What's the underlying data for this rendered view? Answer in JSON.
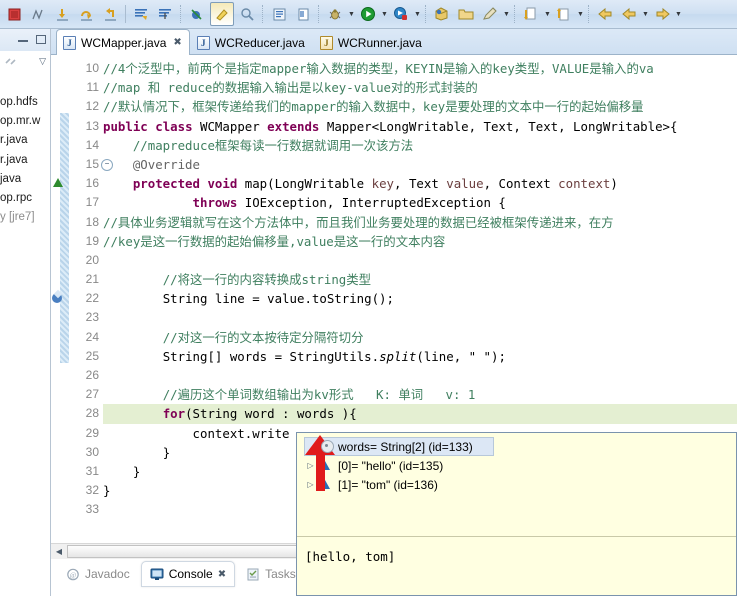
{
  "toolbar": {
    "buttons": [
      {
        "name": "terminate-icon",
        "glyph": "stop"
      },
      {
        "name": "disconnect-icon",
        "glyph": "disconnect"
      },
      {
        "name": "step-into-icon",
        "glyph": "step-into"
      },
      {
        "name": "step-over-icon",
        "glyph": "step-over"
      },
      {
        "name": "step-return-icon",
        "glyph": "step-return"
      },
      {
        "name": "toggle-ant-mark-occurrences-icon",
        "glyph": "lines"
      },
      {
        "name": "next-annotation-icon",
        "glyph": "lines2"
      },
      {
        "name": "skip-all-breakpoints-icon",
        "glyph": "breakpoint"
      },
      {
        "name": "toggle-mark-occurrences-icon",
        "glyph": "highlight"
      },
      {
        "name": "search-icon",
        "glyph": "search"
      },
      {
        "name": "open-type-icon",
        "glyph": "book"
      },
      {
        "name": "open-task-icon",
        "glyph": "task"
      },
      {
        "name": "debug-icon",
        "glyph": "bug"
      },
      {
        "name": "run-icon",
        "glyph": "run"
      },
      {
        "name": "external-tools-icon",
        "glyph": "tools"
      },
      {
        "name": "new-java-package-icon",
        "glyph": "package"
      },
      {
        "name": "open-resource-icon",
        "glyph": "folder"
      },
      {
        "name": "pencil-icon",
        "glyph": "pencil"
      },
      {
        "name": "next-edit-icon",
        "glyph": "edit-next"
      },
      {
        "name": "previous-edit-icon",
        "glyph": "edit-prev"
      },
      {
        "name": "back-icon",
        "glyph": "back"
      },
      {
        "name": "forward-icon",
        "glyph": "forward"
      }
    ]
  },
  "package_explorer": {
    "tree": [
      "op.hdfs",
      "op.mr.w",
      "r.java",
      "r.java",
      "java",
      "op.rpc",
      "y [jre7]"
    ]
  },
  "editor": {
    "tabs": [
      {
        "label": "WCMapper.java",
        "active": true,
        "closable": true,
        "icon": "java-file-icon"
      },
      {
        "label": "WCReducer.java",
        "active": false,
        "closable": false,
        "icon": "java-file-icon"
      },
      {
        "label": "WCRunner.java",
        "active": false,
        "closable": false,
        "icon": "java-file-warning-icon"
      }
    ],
    "lines": [
      {
        "num": 10,
        "marker": "",
        "fold": false,
        "highlight": false
      },
      {
        "num": 11,
        "marker": "",
        "fold": false,
        "highlight": false
      },
      {
        "num": 12,
        "marker": "",
        "fold": false,
        "highlight": false
      },
      {
        "num": 13,
        "marker": "",
        "fold": false,
        "highlight": false
      },
      {
        "num": 14,
        "marker": "",
        "fold": false,
        "highlight": false
      },
      {
        "num": 15,
        "marker": "",
        "fold": true,
        "highlight": false
      },
      {
        "num": 16,
        "marker": "override",
        "fold": false,
        "highlight": false
      },
      {
        "num": 17,
        "marker": "",
        "fold": false,
        "highlight": false
      },
      {
        "num": 18,
        "marker": "",
        "fold": false,
        "highlight": false
      },
      {
        "num": 19,
        "marker": "",
        "fold": false,
        "highlight": false
      },
      {
        "num": 20,
        "marker": "",
        "fold": false,
        "highlight": false
      },
      {
        "num": 21,
        "marker": "",
        "fold": false,
        "highlight": false
      },
      {
        "num": 22,
        "marker": "breakpoint",
        "fold": false,
        "highlight": false
      },
      {
        "num": 23,
        "marker": "",
        "fold": false,
        "highlight": false
      },
      {
        "num": 24,
        "marker": "",
        "fold": false,
        "highlight": false
      },
      {
        "num": 25,
        "marker": "",
        "fold": false,
        "highlight": false
      },
      {
        "num": 26,
        "marker": "",
        "fold": false,
        "highlight": false
      },
      {
        "num": 27,
        "marker": "",
        "fold": false,
        "highlight": false
      },
      {
        "num": 28,
        "marker": "",
        "fold": false,
        "highlight": true
      },
      {
        "num": 29,
        "marker": "",
        "fold": false,
        "highlight": false
      },
      {
        "num": 30,
        "marker": "",
        "fold": false,
        "highlight": false
      },
      {
        "num": 31,
        "marker": "",
        "fold": false,
        "highlight": false
      },
      {
        "num": 32,
        "marker": "",
        "fold": false,
        "highlight": false
      },
      {
        "num": 33,
        "marker": "",
        "fold": false,
        "highlight": false
      }
    ],
    "code": {
      "l10": "//4个泛型中，前两个是指定mapper输入数据的类型，KEYIN是输入的key类型，VALUE是输入的va",
      "l11": "//map 和 reduce的数据输入输出是以key-value对的形式封装的",
      "l12": "//默认情况下，框架传递给我们的mapper的输入数据中，key是要处理的文本中一行的起始偏移量",
      "l13_kw1": "public",
      "l13_kw2": "class",
      "l13_name": "WCMapper",
      "l13_kw3": "extends",
      "l13_rest": "Mapper<LongWritable, Text, Text, LongWritable>{",
      "l14": "//mapreduce框架每读一行数据就调用一次该方法",
      "l15": "@Override",
      "l16_kw1": "protected",
      "l16_kw2": "void",
      "l16_name": "map",
      "l16_p1": "LongWritable",
      "l16_v1": "key",
      "l16_p2": "Text",
      "l16_v2": "value",
      "l16_p3": "Context",
      "l16_v3": "context",
      "l17_kw": "throws",
      "l17_rest": "IOException, InterruptedException {",
      "l18": "//具体业务逻辑就写在这个方法体中，而且我们业务要处理的数据已经被框架传递进来，在方",
      "l19": "//key是这一行数据的起始偏移量,value是这一行的文本内容",
      "l21": "//将这一行的内容转换成string类型",
      "l22_type": "String",
      "l22_rest": "line = value.toString();",
      "l24": "//对这一行的文本按待定分隔符切分",
      "l25_type": "String[]",
      "l25_var": "words",
      "l25_cls": "StringUtils.",
      "l25_m": "split",
      "l25_args": "(line, \" \");",
      "l27": "//遍历这个单词数组输出为kv形式   K: 单词   v: 1",
      "l28_kw": "for",
      "l28_rest": "(String word : words ){",
      "l29": "context.write",
      "l30": "}",
      "l31": "}",
      "l32": "}"
    }
  },
  "scrollbar": {
    "left_arrow": "◀"
  },
  "bottom_tabs": [
    {
      "label": "Javadoc",
      "active": false,
      "icon": "javadoc-icon",
      "closable": false
    },
    {
      "label": "Console",
      "active": true,
      "icon": "console-icon",
      "closable": true
    },
    {
      "label": "Tasks",
      "active": false,
      "icon": "tasks-icon",
      "closable": false
    }
  ],
  "debug_popup": {
    "rows": [
      {
        "label": "words= String[2]  (id=133)",
        "selected": true,
        "expandable": false,
        "kind": "object"
      },
      {
        "label": "[0]= \"hello\" (id=135)",
        "selected": false,
        "expandable": true,
        "kind": "element"
      },
      {
        "label": "[1]= \"tom\" (id=136)",
        "selected": false,
        "expandable": true,
        "kind": "element"
      }
    ],
    "detail": "[hello, tom]",
    "annotation_arrow_color": "#e01b1b"
  },
  "colors": {
    "keyword": "#7f0055",
    "comment": "#3f7f5f",
    "string": "#2a00ff",
    "highlight_line": "#e4efd2",
    "popup_bg": "#ffffe1",
    "selection": "#dce7f5"
  }
}
